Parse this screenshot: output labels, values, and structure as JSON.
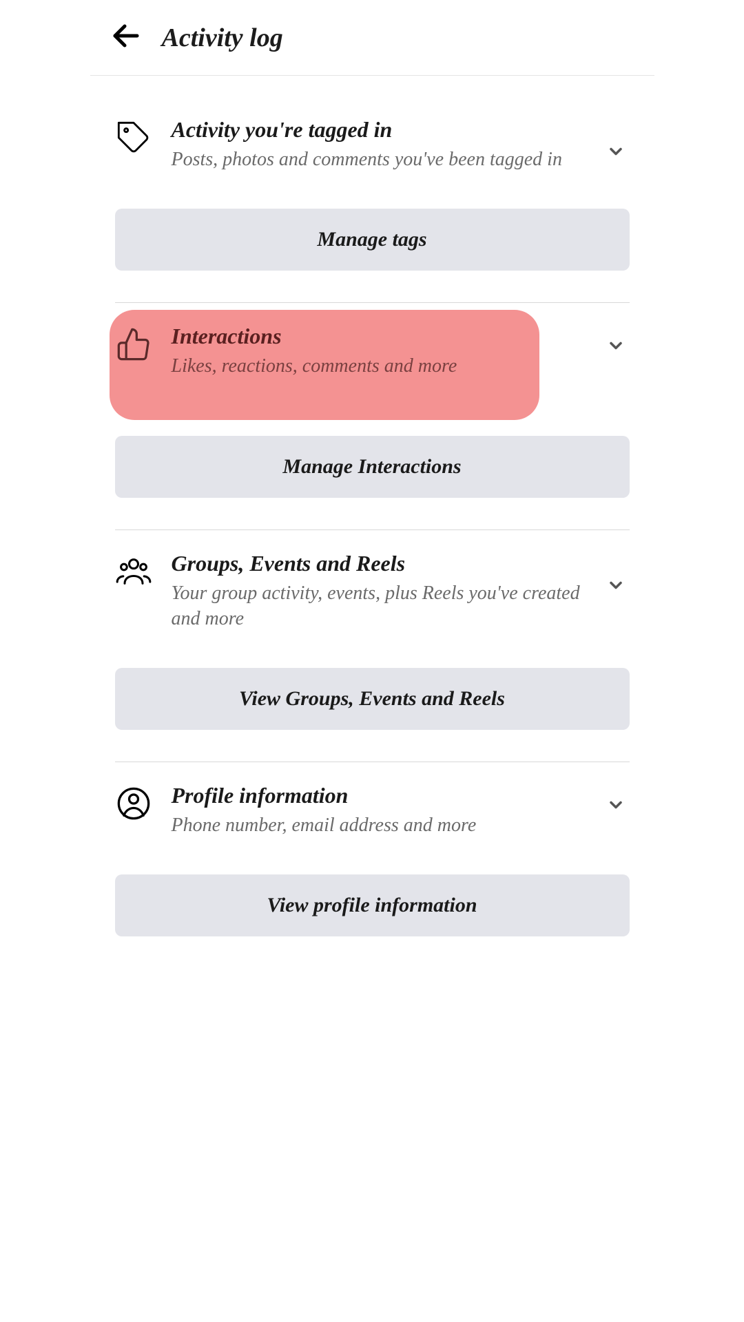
{
  "header": {
    "title": "Activity log"
  },
  "sections": {
    "tagged": {
      "title": "Activity you're tagged in",
      "subtitle": "Posts, photos and comments you've been tagged in",
      "button": "Manage tags"
    },
    "interactions": {
      "title": "Interactions",
      "subtitle": "Likes, reactions, comments and more",
      "button": "Manage Interactions"
    },
    "groups": {
      "title": "Groups, Events and Reels",
      "subtitle": "Your group activity, events, plus Reels you've created and more",
      "button": "View Groups, Events and Reels"
    },
    "profile": {
      "title": "Profile information",
      "subtitle": "Phone number, email address and more",
      "button": "View profile information"
    }
  }
}
